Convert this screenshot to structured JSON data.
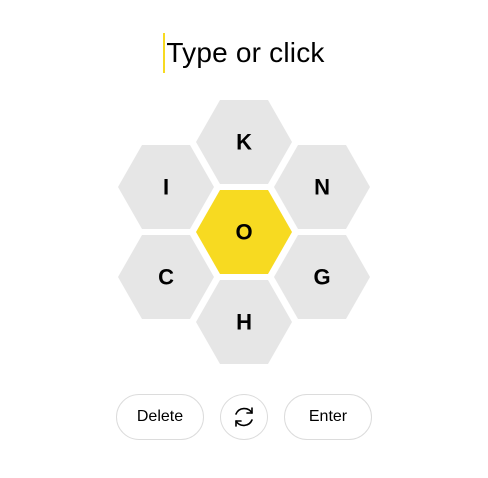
{
  "input": {
    "placeholder": "Type or click"
  },
  "hive": {
    "center_letter": "O",
    "outer_letters": [
      "K",
      "N",
      "G",
      "H",
      "C",
      "I"
    ]
  },
  "controls": {
    "delete_label": "Delete",
    "shuffle_icon": "shuffle-icon",
    "enter_label": "Enter"
  },
  "colors": {
    "center_fill": "#f7da21",
    "outer_fill": "#e6e6e6",
    "cursor": "#f7da21"
  }
}
